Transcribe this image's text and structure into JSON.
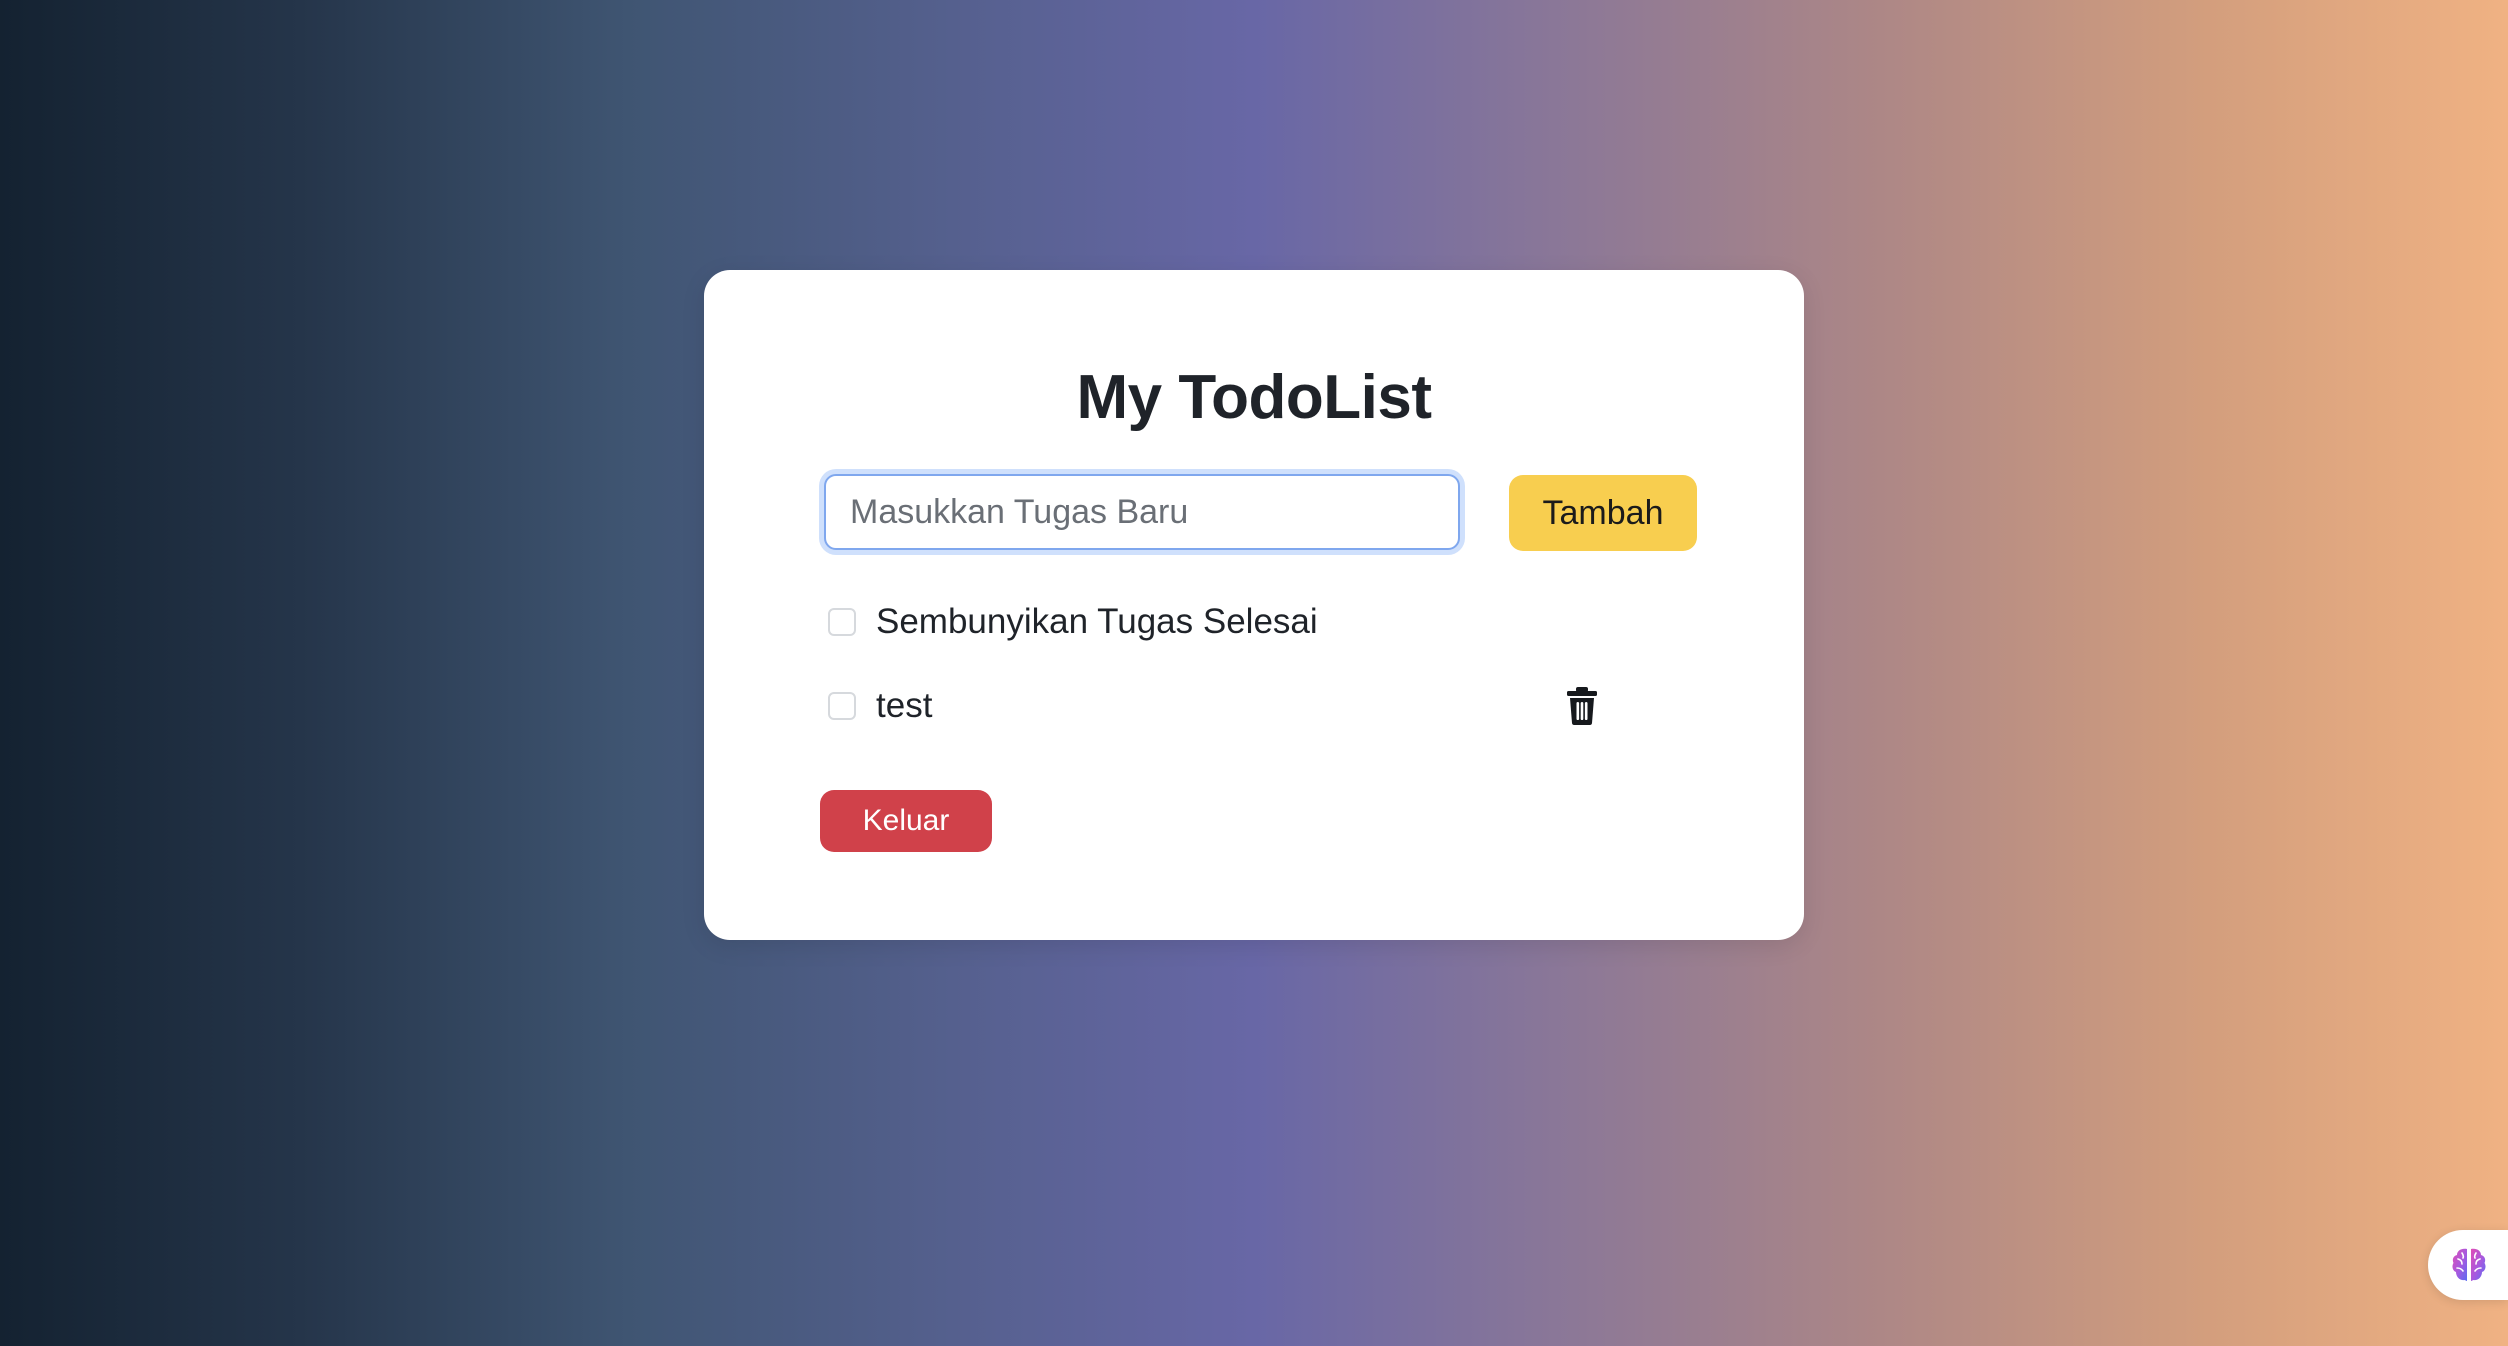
{
  "app": {
    "title": "My TodoList"
  },
  "new_task": {
    "placeholder": "Masukkan Tugas Baru",
    "value": "",
    "add_label": "Tambah"
  },
  "filters": {
    "hide_completed_label": "Sembunyikan Tugas Selesai",
    "hide_completed_checked": false
  },
  "tasks": [
    {
      "label": "test",
      "completed": false,
      "delete_icon": "trash-icon"
    }
  ],
  "actions": {
    "logout_label": "Keluar"
  },
  "floating_helper": {
    "icon": "brain-icon"
  },
  "colors": {
    "add_button": "#f8ce4f",
    "logout_button": "#d0414a",
    "input_focus_ring": "#cfe0fc",
    "gradient_start": "#142231",
    "gradient_mid": "#6867a6",
    "gradient_end": "#f0b283"
  }
}
